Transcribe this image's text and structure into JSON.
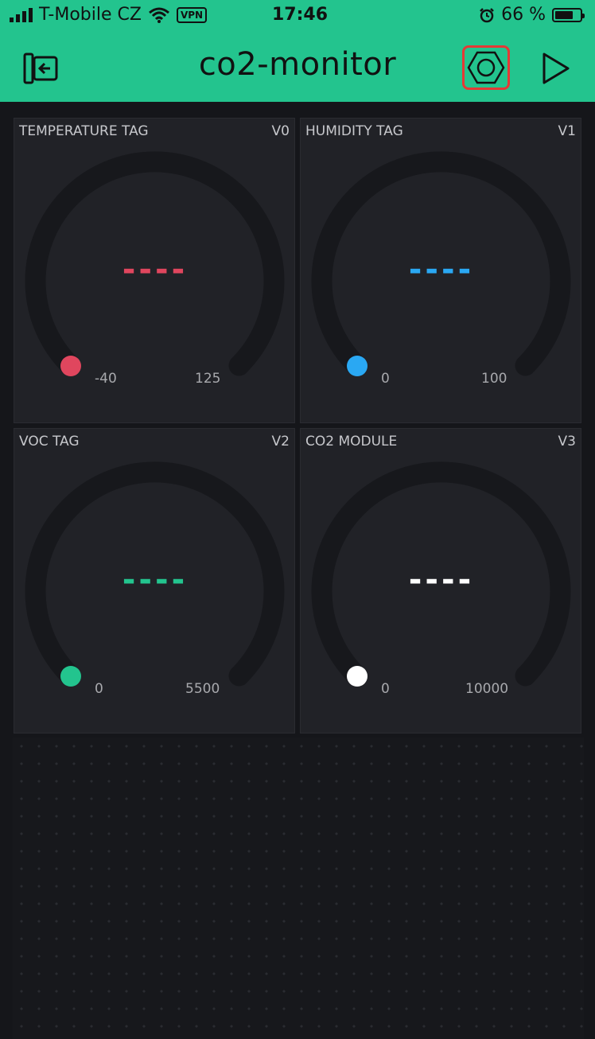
{
  "status": {
    "carrier": "T-Mobile CZ",
    "vpn": "VPN",
    "time": "17:46",
    "battery": "66 %"
  },
  "header": {
    "title": "co2-monitor"
  },
  "widgets": [
    {
      "label": "TEMPERATURE TAG",
      "pin": "V0",
      "value": "----",
      "min": "-40",
      "max": "125",
      "color": "#e0465e"
    },
    {
      "label": "HUMIDITY TAG",
      "pin": "V1",
      "value": "----",
      "min": "0",
      "max": "100",
      "color": "#2aa8f3"
    },
    {
      "label": "VOC TAG",
      "pin": "V2",
      "value": "----",
      "min": "0",
      "max": "5500",
      "color": "#23c48e"
    },
    {
      "label": "CO2 MODULE",
      "pin": "V3",
      "value": "----",
      "min": "0",
      "max": "10000",
      "color": "#ffffff"
    }
  ]
}
